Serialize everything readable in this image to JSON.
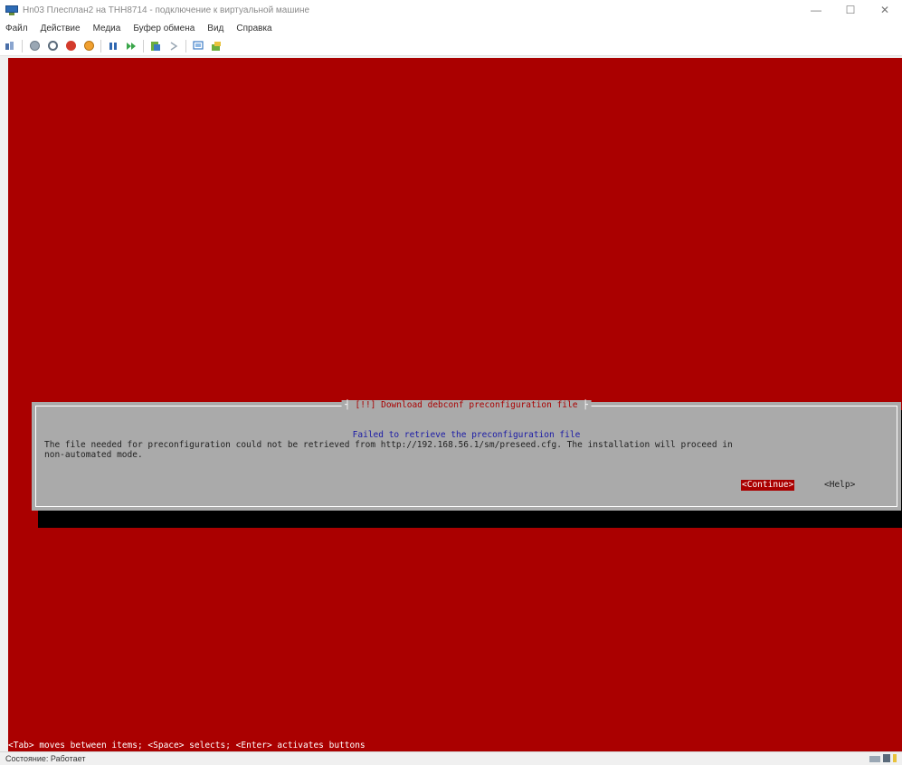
{
  "window": {
    "title": "Hn03 Плесплан2 на ТНН8714 - подключение к виртуальной машине",
    "minimize": "—",
    "maximize": "☐",
    "close": "✕"
  },
  "menu": {
    "items": [
      "Файл",
      "Действие",
      "Медиа",
      "Буфер обмена",
      "Вид",
      "Справка"
    ]
  },
  "toolbar": {
    "icons": [
      "ctrl-alt-del-icon",
      "start-icon",
      "turn-off-icon",
      "shutdown-icon",
      "save-icon",
      "pause-icon",
      "reset-icon",
      "checkpoint-icon",
      "revert-icon",
      "enhanced-session-icon",
      "share-icon"
    ]
  },
  "installer": {
    "dialog_title": "[!!] Download debconf preconfiguration file",
    "heading": "Failed to retrieve the preconfiguration file",
    "body_line1": "The file needed for preconfiguration could not be retrieved from http://192.168.56.1/sm/preseed.cfg. The installation will proceed in",
    "body_line2": "non-automated mode.",
    "continue_label": "<Continue>",
    "help_label": "<Help>",
    "hint": "<Tab> moves between items; <Space> selects; <Enter> activates buttons"
  },
  "status": {
    "text": "Состояние: Работает"
  },
  "colors": {
    "screen_bg": "#aa0000",
    "dialog_bg": "#aaaaaa",
    "heading": "#1a1aa6"
  }
}
